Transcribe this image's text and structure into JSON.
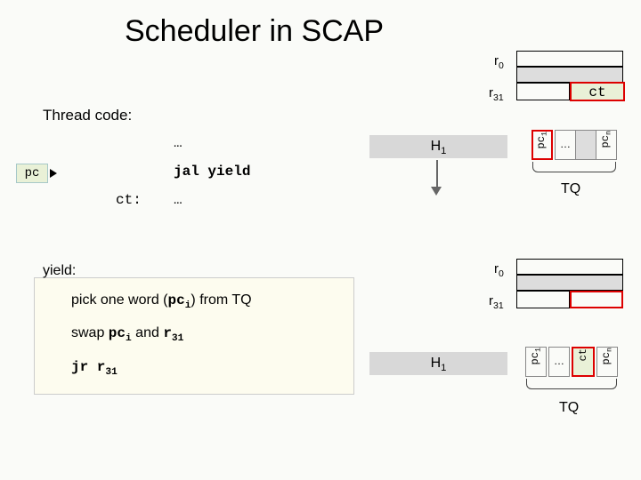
{
  "title": "Scheduler in SCAP",
  "regs": {
    "r0": "r<sub>0</sub>",
    "r31": "r<sub>31</sub>",
    "ct": "ct"
  },
  "thread": {
    "label": "Thread code:",
    "dots": "…",
    "jal": "jal yield",
    "ctlbl": "ct:",
    "pc": "pc"
  },
  "heap": "H<sub>1</sub>",
  "tq": "TQ",
  "tqcells": {
    "pc1": "pc<sub>1</sub>",
    "pcn": "pc<sub>n</sub>",
    "dots": "…"
  },
  "yield": {
    "label": "yield:",
    "l1a": "pick one word (",
    "l1b": "pc<sub>i</sub>",
    "l1c": ") from TQ",
    "l2a": "swap ",
    "l2b": "pc<sub>i</sub>",
    "l2c": " and ",
    "l2d": "r<sub>31</sub>",
    "l3a": "jr r<sub>31</sub>"
  },
  "bottomtq": {
    "pc1": "pc<sub>1</sub>",
    "pcn": "pc<sub>n</sub>",
    "ct": "ct",
    "dots": "…"
  }
}
